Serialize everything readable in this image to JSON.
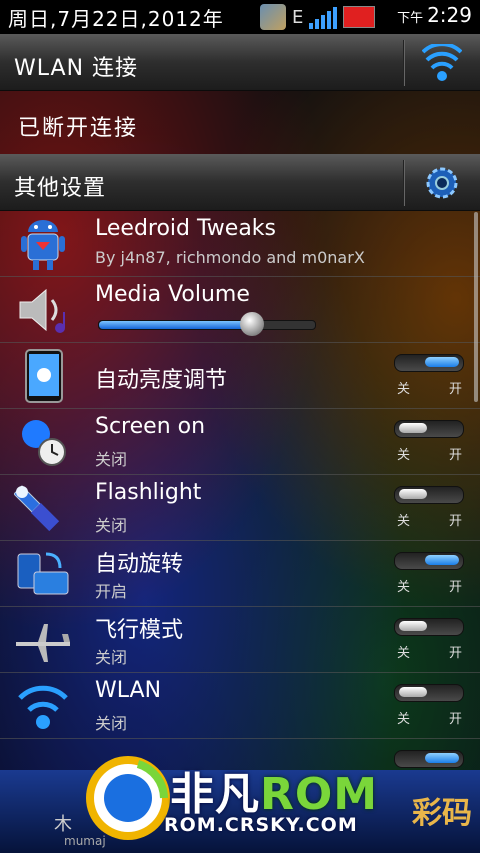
{
  "status_bar": {
    "date": "周日,7月22日,2012年",
    "network": "E",
    "ampm": "下午",
    "time": "2:29"
  },
  "wlan_header": {
    "label": "WLAN 连接",
    "icon": "wifi-icon"
  },
  "disconnected": {
    "label": "已断开连接"
  },
  "other_settings": {
    "label": "其他设置",
    "icon": "gear-icon"
  },
  "items": [
    {
      "title": "Leedroid Tweaks",
      "subtitle": "By j4n87, richmondo and m0narX",
      "icon": "android-robot-icon"
    },
    {
      "title": "Media Volume",
      "icon": "speaker-icon",
      "volume_fraction": 0.71
    },
    {
      "title": "自动亮度调节",
      "icon": "brightness-icon",
      "toggle": "on",
      "off_label": "关",
      "on_label": "开"
    },
    {
      "title": "Screen on",
      "subtitle": "关闭",
      "icon": "bulb-clock-icon",
      "toggle": "off",
      "off_label": "关",
      "on_label": "开"
    },
    {
      "title": "Flashlight",
      "subtitle": "关闭",
      "icon": "flashlight-icon",
      "toggle": "off",
      "off_label": "关",
      "on_label": "开"
    },
    {
      "title": "自动旋转",
      "subtitle": "开启",
      "icon": "rotate-icon",
      "toggle": "on",
      "off_label": "关",
      "on_label": "开"
    },
    {
      "title": "飞行模式",
      "subtitle": "关闭",
      "icon": "airplane-icon",
      "toggle": "off",
      "off_label": "关",
      "on_label": "开"
    },
    {
      "title": "WLAN",
      "subtitle": "关闭",
      "icon": "wifi-icon",
      "toggle": "off",
      "off_label": "关",
      "on_label": "开"
    }
  ],
  "watermark": {
    "brand_a": "非凡",
    "brand_b": "ROM",
    "url": "ROM.CRSKY.COM",
    "left_label": "木",
    "left_small": "mumaj",
    "right_label": "彩码"
  },
  "colors": {
    "accent_blue": "#1a7ee8",
    "header_gray": "#3a3a3a"
  }
}
